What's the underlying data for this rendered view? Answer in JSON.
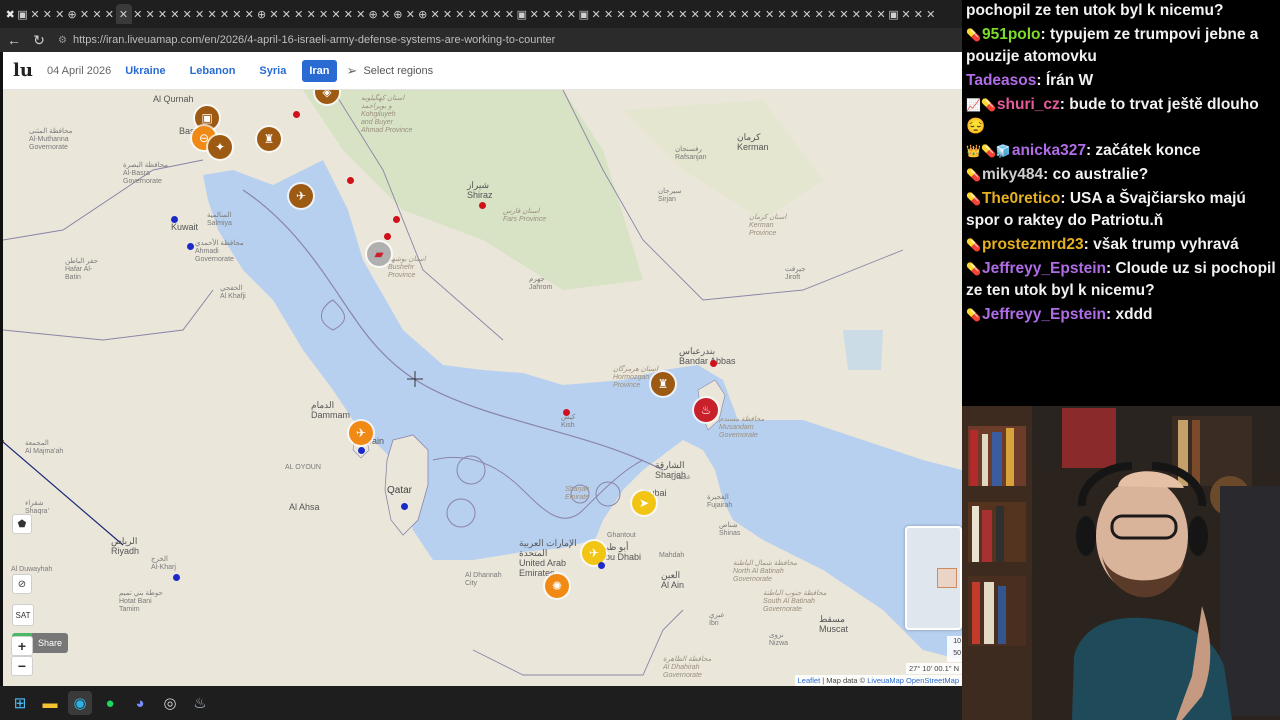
{
  "browser": {
    "tabs": [
      "✖",
      "▣",
      "✕",
      "✕",
      "✕",
      "⊕",
      "✕",
      "✕",
      "✕",
      "✕",
      "✕",
      "✕",
      "✕",
      "✕",
      "✕",
      "✕",
      "✕",
      "✕",
      "✕",
      "✕",
      "⊕",
      "✕",
      "✕",
      "✕",
      "✕",
      "✕",
      "✕",
      "✕",
      "✕",
      "⊕",
      "✕",
      "⊕",
      "✕",
      "⊕",
      "✕",
      "✕",
      "✕",
      "✕",
      "✕",
      "✕",
      "✕",
      "▣",
      "✕",
      "✕",
      "✕",
      "✕",
      "▣",
      "✕",
      "✕",
      "✕",
      "✕",
      "✕",
      "✕",
      "✕",
      "✕",
      "✕",
      "✕",
      "✕",
      "✕",
      "✕",
      "✕",
      "✕",
      "✕",
      "✕",
      "✕",
      "✕",
      "✕",
      "✕",
      "✕",
      "✕",
      "✕",
      "▣",
      "✕",
      "✕",
      "✕"
    ],
    "url": "https://iran.liveuamap.com/en/2026/4-april-16-israeli-army-defense-systems-are-working-to-counter"
  },
  "header": {
    "logo": "lu",
    "date": "04 April 2026",
    "regions": [
      "Ukraine",
      "Lebanon",
      "Syria",
      "Iran"
    ],
    "active_region": "Iran",
    "select_regions": "Select regions"
  },
  "map": {
    "colors": {
      "sea": "#b8d0f0",
      "land": "#ebe6da",
      "border": "#8a84a8",
      "green": "#c6dcb0"
    },
    "labels": {
      "alqurnah": "Al Qurnah",
      "basra": "Basra",
      "muthanna": "محافظة المثنى\nAl-Muthanna\nGovernorate",
      "basra_gov": "محافظة البصرة\nAl-Basra\nGovernorate",
      "kuwait": "Kuwait",
      "salmiya": "السالمية\nSalmiya",
      "ahmadi": "محافظة الأحمدي\nAhmadi\nGovernorate",
      "hafar": "حفر الباطن\nHafar Al-\nBatin",
      "khafji": "الخفجي\nAl Khafji",
      "kohgiluyeh": "استان کهگیلویه\nو بویراحمد\nKohgiluyeh\nand Buyer\nAhmad Province",
      "shiraz": "شیراز\nShiraz",
      "fars": "استان فارس\nFars Province",
      "bushehr": "استان بوشهر\nBushehr\nProvince",
      "jahrom": "جهرم\nJahrom",
      "kerman": "کرمان\nKerman",
      "rafsanjan": "رفسنجان\nRafsanjan",
      "sirjan": "سیرجان\nSirjan",
      "kerman_prov": "استان کرمان\nKerman\nProvince",
      "jiroft": "جیرفت\nJiroft",
      "bandar": "بندرعباس\nBandar Abbas",
      "hormozgan": "استان هرمزگان\nHormozgan\nProvince",
      "kish": "کیش\nKish",
      "musandam": "محافظة مسندم\nMusandam\nGovernorate",
      "dammam": "الدمام\nDammam",
      "bahrain": "Bahrain",
      "qatar": "Qatar",
      "alahsa": "Al Ahsa",
      "aloyoun": "AL OYOUN",
      "majmaah": "المجمعة\nAl Majma'ah",
      "shaqra": "شقراء\nShaqra'",
      "riyadh": "الرياض\nRiyadh",
      "alkharj": "الخرج\nAl-Kharj",
      "hotat": "حوطة بني تميم\nHotat Bani\nTamim",
      "alduwayhah": "Al Duwayhah",
      "sharjah": "الشارقة\nSharjah",
      "sharjah_em": "Sharjah\nEmirate",
      "dubai": "Dubai",
      "ajman": "عجمان",
      "fujairah": "الفجيرة\nFujairah",
      "mahdah": "Mahdah",
      "shinas": "شناص\nShinas",
      "uae": "الإمارات العربية\nالمتحدة\nUnited Arab\nEmirates",
      "abudhabi": "أبو ظبي\nAbu Dhabi",
      "ghantout": "Ghantout",
      "aldhannah": "Al Dhannah\nCity",
      "alain": "العين\nAl Ain",
      "north_batinah": "محافظة شمال الباطنة\nNorth Al Batinah\nGovernorate",
      "south_batinah": "محافظة جنوب الباطنة\nSouth Al Batinah\nGovernorate",
      "muscat": "مسقط\nMuscat",
      "ibri": "عبري\nIbri",
      "nizwa": "نزوى\nNizwa",
      "dhahirah": "محافظة الظاهرة\nAl Dhahirah\nGovernorate"
    }
  },
  "controls": {
    "share": "Share",
    "sat": "SAT",
    "zoom_in": "+",
    "zoom_out": "−",
    "coords": "27° 10' 00.1\" N",
    "scale_top": "10",
    "scale_bottom": "50",
    "attribution_leaflet": "Leaflet",
    "attribution_sep": " | Map data © ",
    "attribution_lum": "LiveuaMap",
    "attribution_osm": " OpenStreetMap"
  },
  "taskbar": {
    "icons": [
      "windows-icon",
      "explorer-icon",
      "edge-icon",
      "spotify-icon",
      "discord-icon",
      "chrome-icon",
      "steam-icon"
    ]
  },
  "chat": {
    "messages": [
      {
        "badges": "",
        "user": "",
        "color": "#ffffff",
        "text": "pochopil ze ten utok byl k nicemu?"
      },
      {
        "badges": "💊",
        "user": "951polo",
        "color": "#7ddc2a",
        "text": "typujem ze trumpovi jebne a pouzije atomovku"
      },
      {
        "badges": "",
        "user": "Tadeasos",
        "color": "#b06ce6",
        "text": "Írán W"
      },
      {
        "badges": "📈💊",
        "user": "shuri_cz",
        "color": "#e65a9a",
        "text": "bude to trvat ještě dlouho 😔"
      },
      {
        "badges": "👑💊🧊",
        "user": "anicka327",
        "color": "#b06ce6",
        "text": "začátek konce"
      },
      {
        "badges": "💊",
        "user": "miky484",
        "color": "#cfcfcf",
        "text": "co australie?"
      },
      {
        "badges": "💊",
        "user": "The0retico",
        "color": "#e6b020",
        "text": "USA a Švajčiarsko majú spor o raktey do Patriotu.ň"
      },
      {
        "badges": "💊",
        "user": "prostezmrd23",
        "color": "#e6b020",
        "text": "však trump vyhravá"
      },
      {
        "badges": "💊",
        "user": "Jeffreyy_Epstein",
        "color": "#b06ce6",
        "text": "Cloude uz si pochopil ze ten utok byl k nicemu?"
      },
      {
        "badges": "💊",
        "user": "Jeffreyy_Epstein",
        "color": "#b06ce6",
        "text": "xddd"
      }
    ]
  }
}
